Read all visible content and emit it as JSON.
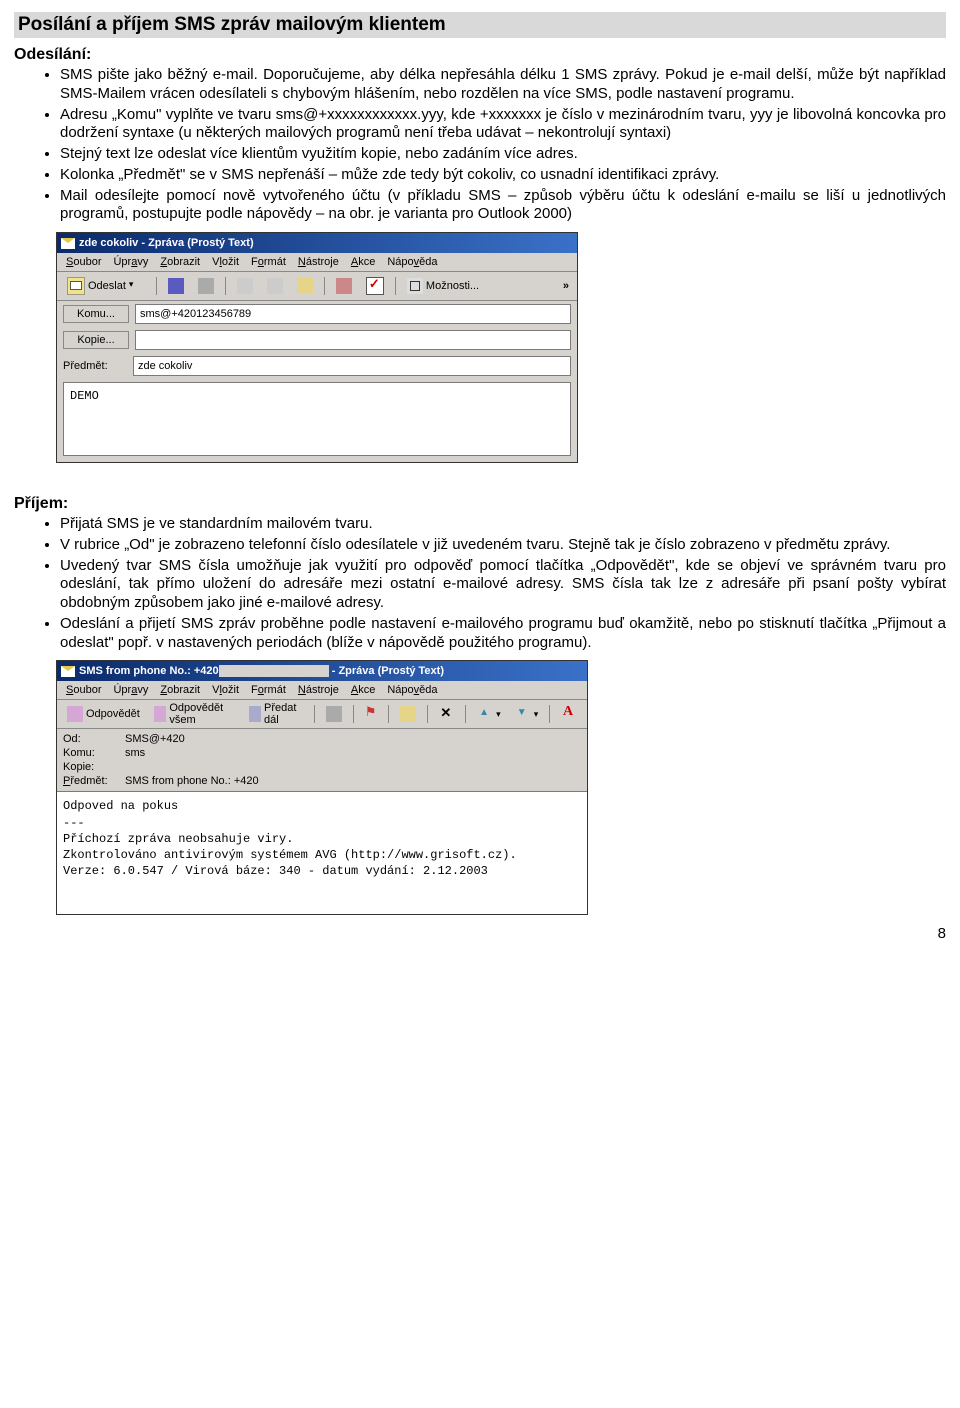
{
  "heading": "Posílání a příjem SMS zpráv mailovým klientem",
  "send": {
    "title": "Odesílání:",
    "bullets": [
      "SMS pište jako běžný e-mail. Doporučujeme, aby délka nepřesáhla délku 1 SMS zprávy. Pokud je e-mail delší, může být například SMS-Mailem vrácen odesílateli s chybovým hlášením, nebo rozdělen na více SMS, podle nastavení programu.",
      "Adresu „Komu\" vyplňte ve tvaru sms@+xxxxxxxxxxxx.yyy, kde +xxxxxxx je číslo v mezinárodním tvaru, yyy je libovolná koncovka pro dodržení syntaxe (u některých mailových programů není třeba udávat – nekontrolují syntaxi)",
      "Stejný text lze odeslat více klientům využitím kopie, nebo zadáním více adres.",
      "Kolonka „Předmět\" se v SMS nepřenáší – může zde tedy být cokoliv, co usnadní identifikaci zprávy.",
      "Mail odesílejte pomocí nově vytvořeného účtu (v příkladu SMS – způsob výběru účtu k odeslání e-mailu se liší u jednotlivých programů, postupujte podle nápovědy – na obr. je varianta pro Outlook 2000)"
    ]
  },
  "recv": {
    "title": "Příjem:",
    "bullets": [
      "Přijatá SMS je ve standardním mailovém tvaru.",
      "V rubrice „Od\" je zobrazeno telefonní číslo odesílatele v již uvedeném tvaru. Stejně tak je číslo zobrazeno v předmětu zprávy.",
      "Uvedený tvar SMS čísla umožňuje jak využití pro odpověď pomocí tlačítka „Odpovědět\", kde se objeví ve správném tvaru pro odeslání, tak přímo uložení do adresáře mezi ostatní e-mailové adresy. SMS čísla tak lze z adresáře při psaní pošty vybírat obdobným způsobem jako jiné e-mailové adresy.",
      "Odeslání a přijetí SMS zpráv proběhne podle nastavení e-mailového programu buď okamžitě, nebo po stisknutí tlačítka „Přijmout a odeslat\" popř. v nastavených periodách (blíže v nápovědě použitého programu)."
    ]
  },
  "win1": {
    "title": "zde cokoliv - Zpráva (Prostý Text)",
    "menus": [
      "Soubor",
      "Úpravy",
      "Zobrazit",
      "Vložit",
      "Formát",
      "Nástroje",
      "Akce",
      "Nápověda"
    ],
    "send_btn": "Odeslat",
    "options_btn": "Možnosti...",
    "fields": {
      "to_btn": "Komu...",
      "to_val": "sms@+420123456789",
      "cc_btn": "Kopie...",
      "cc_val": "",
      "subj_lbl": "Předmět:",
      "subj_val": "zde cokoliv"
    },
    "body": "DEMO"
  },
  "win2": {
    "title_full": "SMS from phone No.: +420                - Zpráva (Prostý Text)",
    "menus": [
      "Soubor",
      "Úpravy",
      "Zobrazit",
      "Vložit",
      "Formát",
      "Nástroje",
      "Akce",
      "Nápověda"
    ],
    "reply": "Odpovědět",
    "replyall": "Odpovědět všem",
    "forward": "Předat dál",
    "hdr": {
      "from_lbl": "Od:",
      "from_val": "SMS@+420",
      "to_lbl": "Komu:",
      "to_val": "sms",
      "cc_lbl": "Kopie:",
      "cc_val": "",
      "subj_lbl": "Předmět:",
      "subj_val": "SMS from phone No.: +420"
    },
    "body": "Odpoved na pokus\n---\nPříchozí zpráva neobsahuje viry.\nZkontrolováno antivirovým systémem AVG (http://www.grisoft.cz).\nVerze: 6.0.547 / Virová báze: 340 - datum vydání: 2.12.2003"
  },
  "page_number": "8"
}
